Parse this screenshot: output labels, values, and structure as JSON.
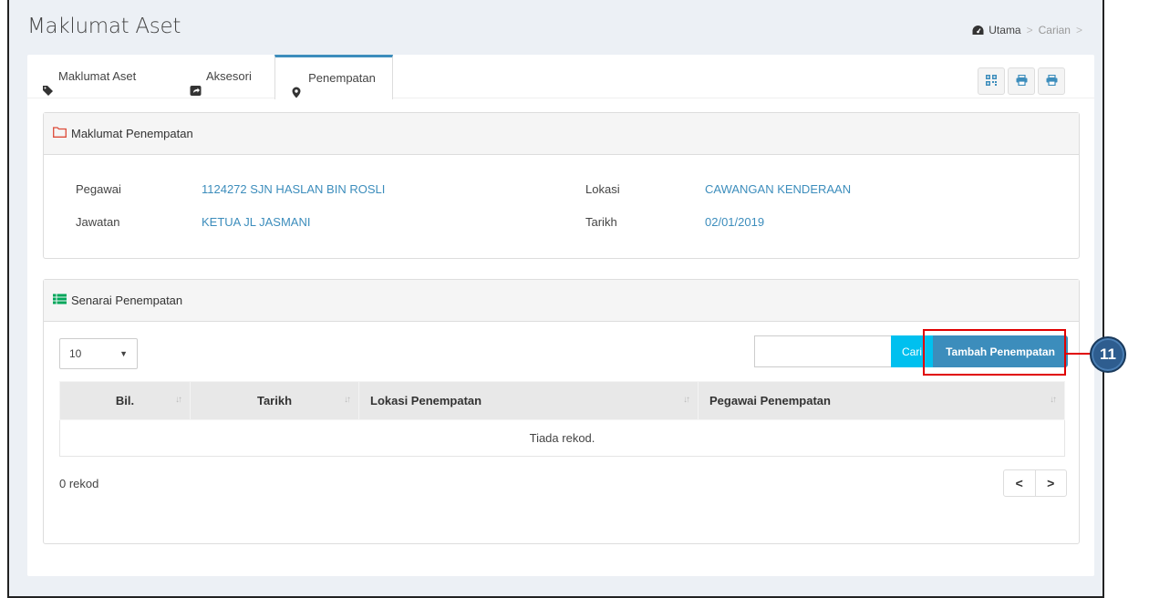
{
  "header": {
    "title": "Maklumat Aset",
    "breadcrumb": {
      "home": "Utama",
      "separator": ">",
      "current": "Carian"
    }
  },
  "tabs": [
    {
      "label": "Maklumat Aset",
      "icon": "tag-icon"
    },
    {
      "label": "Aksesori",
      "icon": "share-square-icon"
    },
    {
      "label": "Penempatan",
      "icon": "map-marker-icon",
      "active": true
    }
  ],
  "toolbar": {
    "buttons": [
      "qrcode-icon",
      "print-icon",
      "print-icon"
    ]
  },
  "placement_info": {
    "heading": "Maklumat Penempatan",
    "pegawai_label": "Pegawai",
    "pegawai_value": "1124272 SJN HASLAN BIN ROSLI",
    "jawatan_label": "Jawatan",
    "jawatan_value": "KETUA JL JASMANI",
    "lokasi_label": "Lokasi",
    "lokasi_value": "CAWANGAN KENDERAAN",
    "tarikh_label": "Tarikh",
    "tarikh_value": "02/01/2019"
  },
  "placement_list": {
    "heading": "Senarai Penempatan",
    "page_size": "10",
    "search_value": "",
    "search_button": "Cari",
    "add_button": "Tambah Penempatan",
    "columns": [
      "Bil.",
      "Tarikh",
      "Lokasi Penempatan",
      "Pegawai Penempatan"
    ],
    "empty_text": "Tiada rekod.",
    "record_count": "0 rekod",
    "pager_prev": "<",
    "pager_next": ">"
  },
  "annotation": {
    "callout_number": "11",
    "color": "#e00000"
  },
  "colors": {
    "primary": "#3c8dbc",
    "info": "#00c0ef",
    "success": "#00a65a",
    "danger": "#dd4b39"
  }
}
